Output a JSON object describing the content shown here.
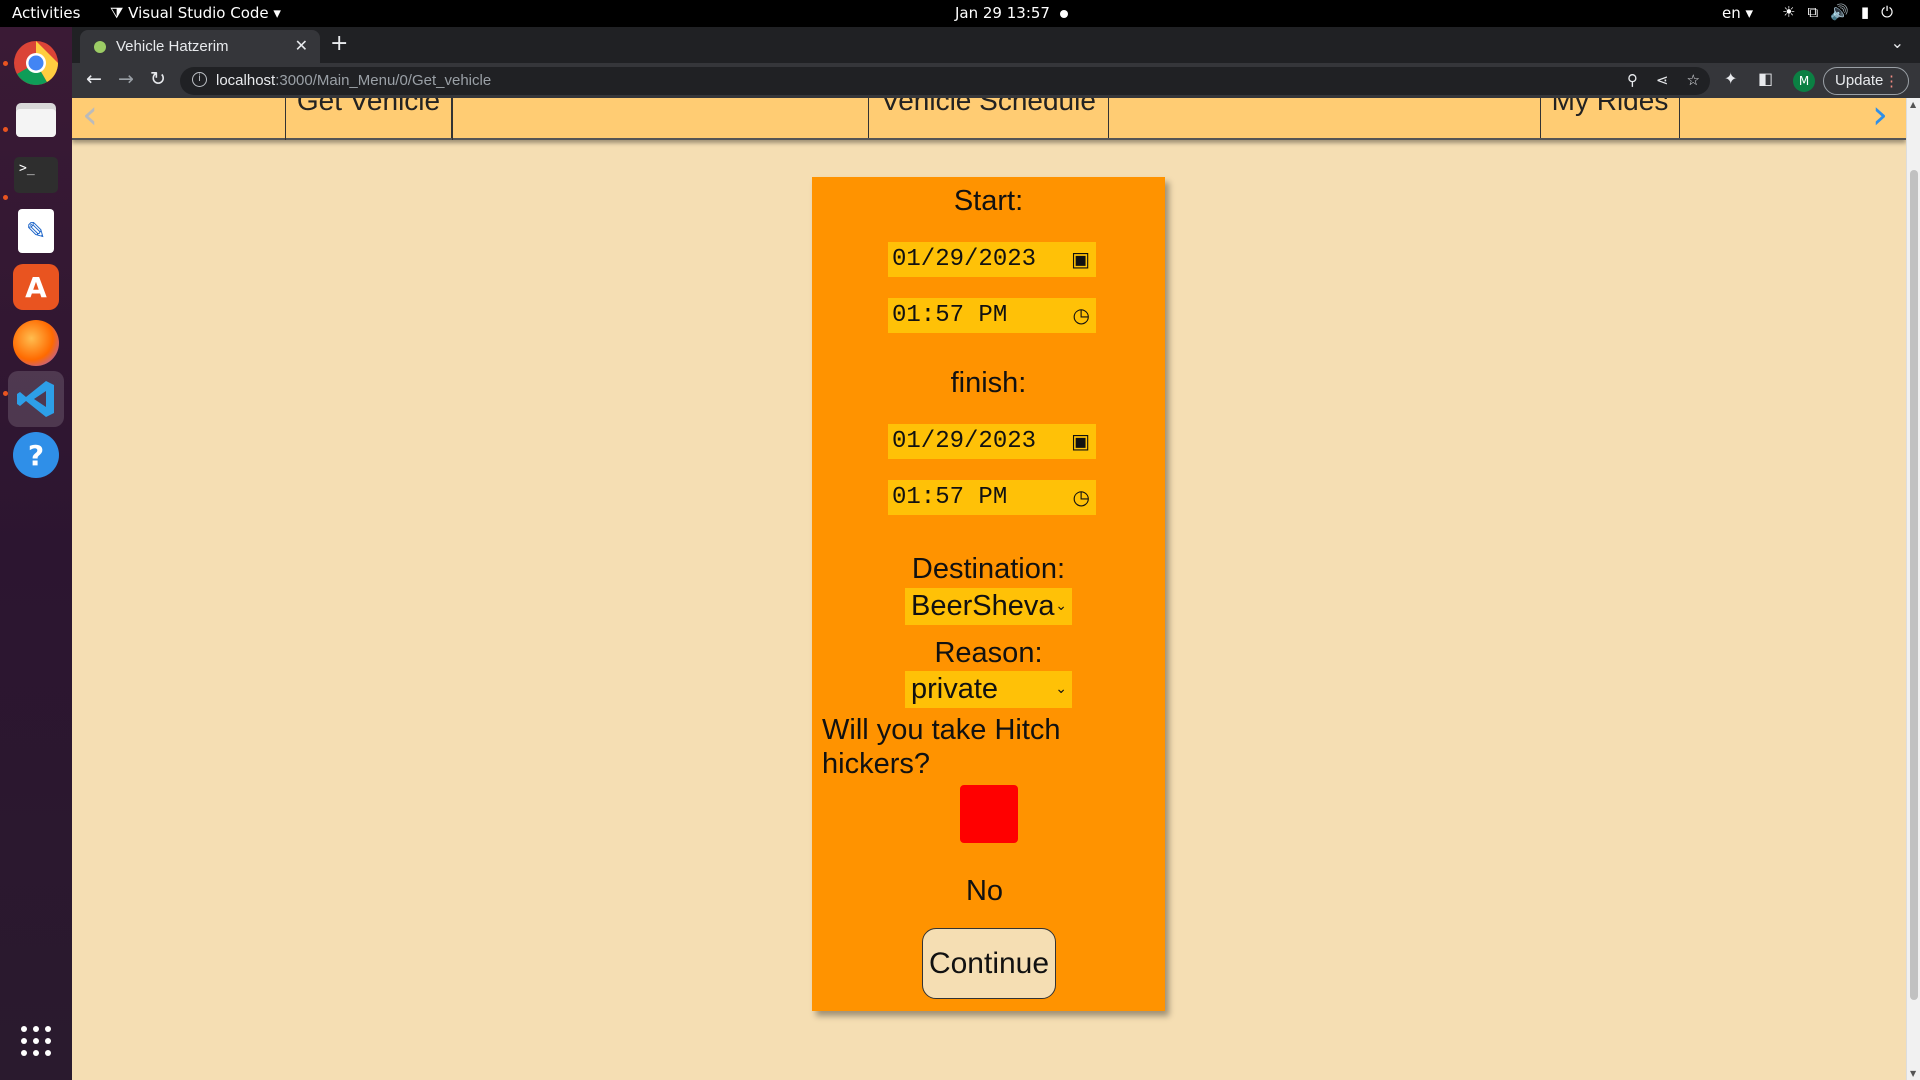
{
  "topbar": {
    "activities": "Activities",
    "app_menu": "Visual Studio Code",
    "clock": "Jan 29  13:57",
    "language": "en"
  },
  "dock": {
    "items": [
      "chrome-icon",
      "files-icon",
      "terminal-icon",
      "text-editor-icon",
      "app-center-icon",
      "firefox-icon",
      "vscode-icon",
      "help-icon",
      "show-apps-icon"
    ]
  },
  "browser": {
    "tab_title": "Vehicle Hatzerim",
    "url_host": "localhost",
    "url_path": ":3000/Main_Menu/0/Get_vehicle",
    "profile_initial": "M",
    "update_label": "Update"
  },
  "navbar": {
    "items": [
      "Get Vehicle",
      "Vehicle Schedule",
      "My Rides"
    ]
  },
  "form": {
    "start_label": "Start:",
    "start_date": "01/29/2023",
    "start_time": "01:57 PM",
    "finish_label": "finish:",
    "finish_date": "01/29/2023",
    "finish_time": "01:57 PM",
    "destination_label": "Destination:",
    "destination_value": "BeerSheva",
    "reason_label": "Reason:",
    "reason_value": "private",
    "hitch_question": "Will you take Hitch hickers?",
    "hitch_value": "No",
    "hitch_color": "#ff0000",
    "continue_label": "Continue"
  },
  "colors": {
    "page_bg": "#f5deb3",
    "card_bg": "#ff9300",
    "field_bg": "#ffc107",
    "navbar_bg": "#ffcc73"
  }
}
